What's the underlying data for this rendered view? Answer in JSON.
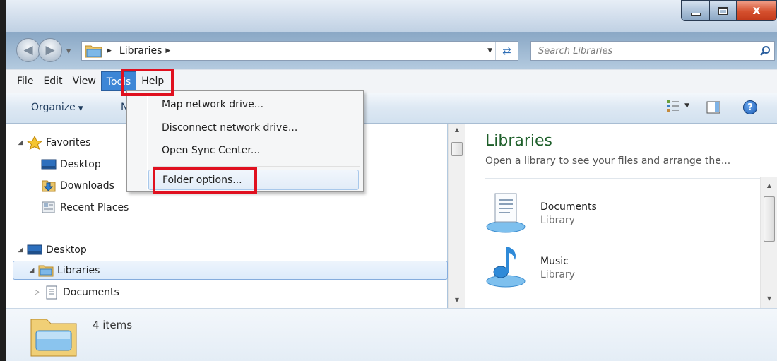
{
  "window": {
    "caption_buttons": [
      "minimize",
      "maximize",
      "close"
    ],
    "close_glyph": "x"
  },
  "address": {
    "path": [
      "Libraries"
    ],
    "search_placeholder": "Search Libraries"
  },
  "menubar": {
    "items": [
      "File",
      "Edit",
      "View",
      "Tools",
      "Help"
    ],
    "active": "Tools"
  },
  "toolbar": {
    "organize_label": "Organize",
    "partial_label": "N"
  },
  "tools_menu": {
    "items": [
      "Map network drive...",
      "Disconnect network drive...",
      "Open Sync Center...",
      "Folder options..."
    ],
    "highlighted": "Folder options..."
  },
  "nav_tree": {
    "favorites": {
      "label": "Favorites",
      "children": [
        "Desktop",
        "Downloads",
        "Recent Places"
      ]
    },
    "desktop": {
      "label": "Desktop",
      "children": [
        "Libraries"
      ],
      "libraries_children": [
        "Documents"
      ]
    },
    "selected": "Libraries"
  },
  "content": {
    "title": "Libraries",
    "subtitle": "Open a library to see your files and arrange the...",
    "libraries": [
      {
        "name": "Documents",
        "kind": "Library",
        "icon": "documents-library-icon"
      },
      {
        "name": "Music",
        "kind": "Library",
        "icon": "music-library-icon"
      }
    ]
  },
  "details": {
    "count": "4 items"
  },
  "colors": {
    "highlight_box": "#e0101f",
    "menu_active": "#3d86d6",
    "title_green": "#1e5f2a"
  }
}
